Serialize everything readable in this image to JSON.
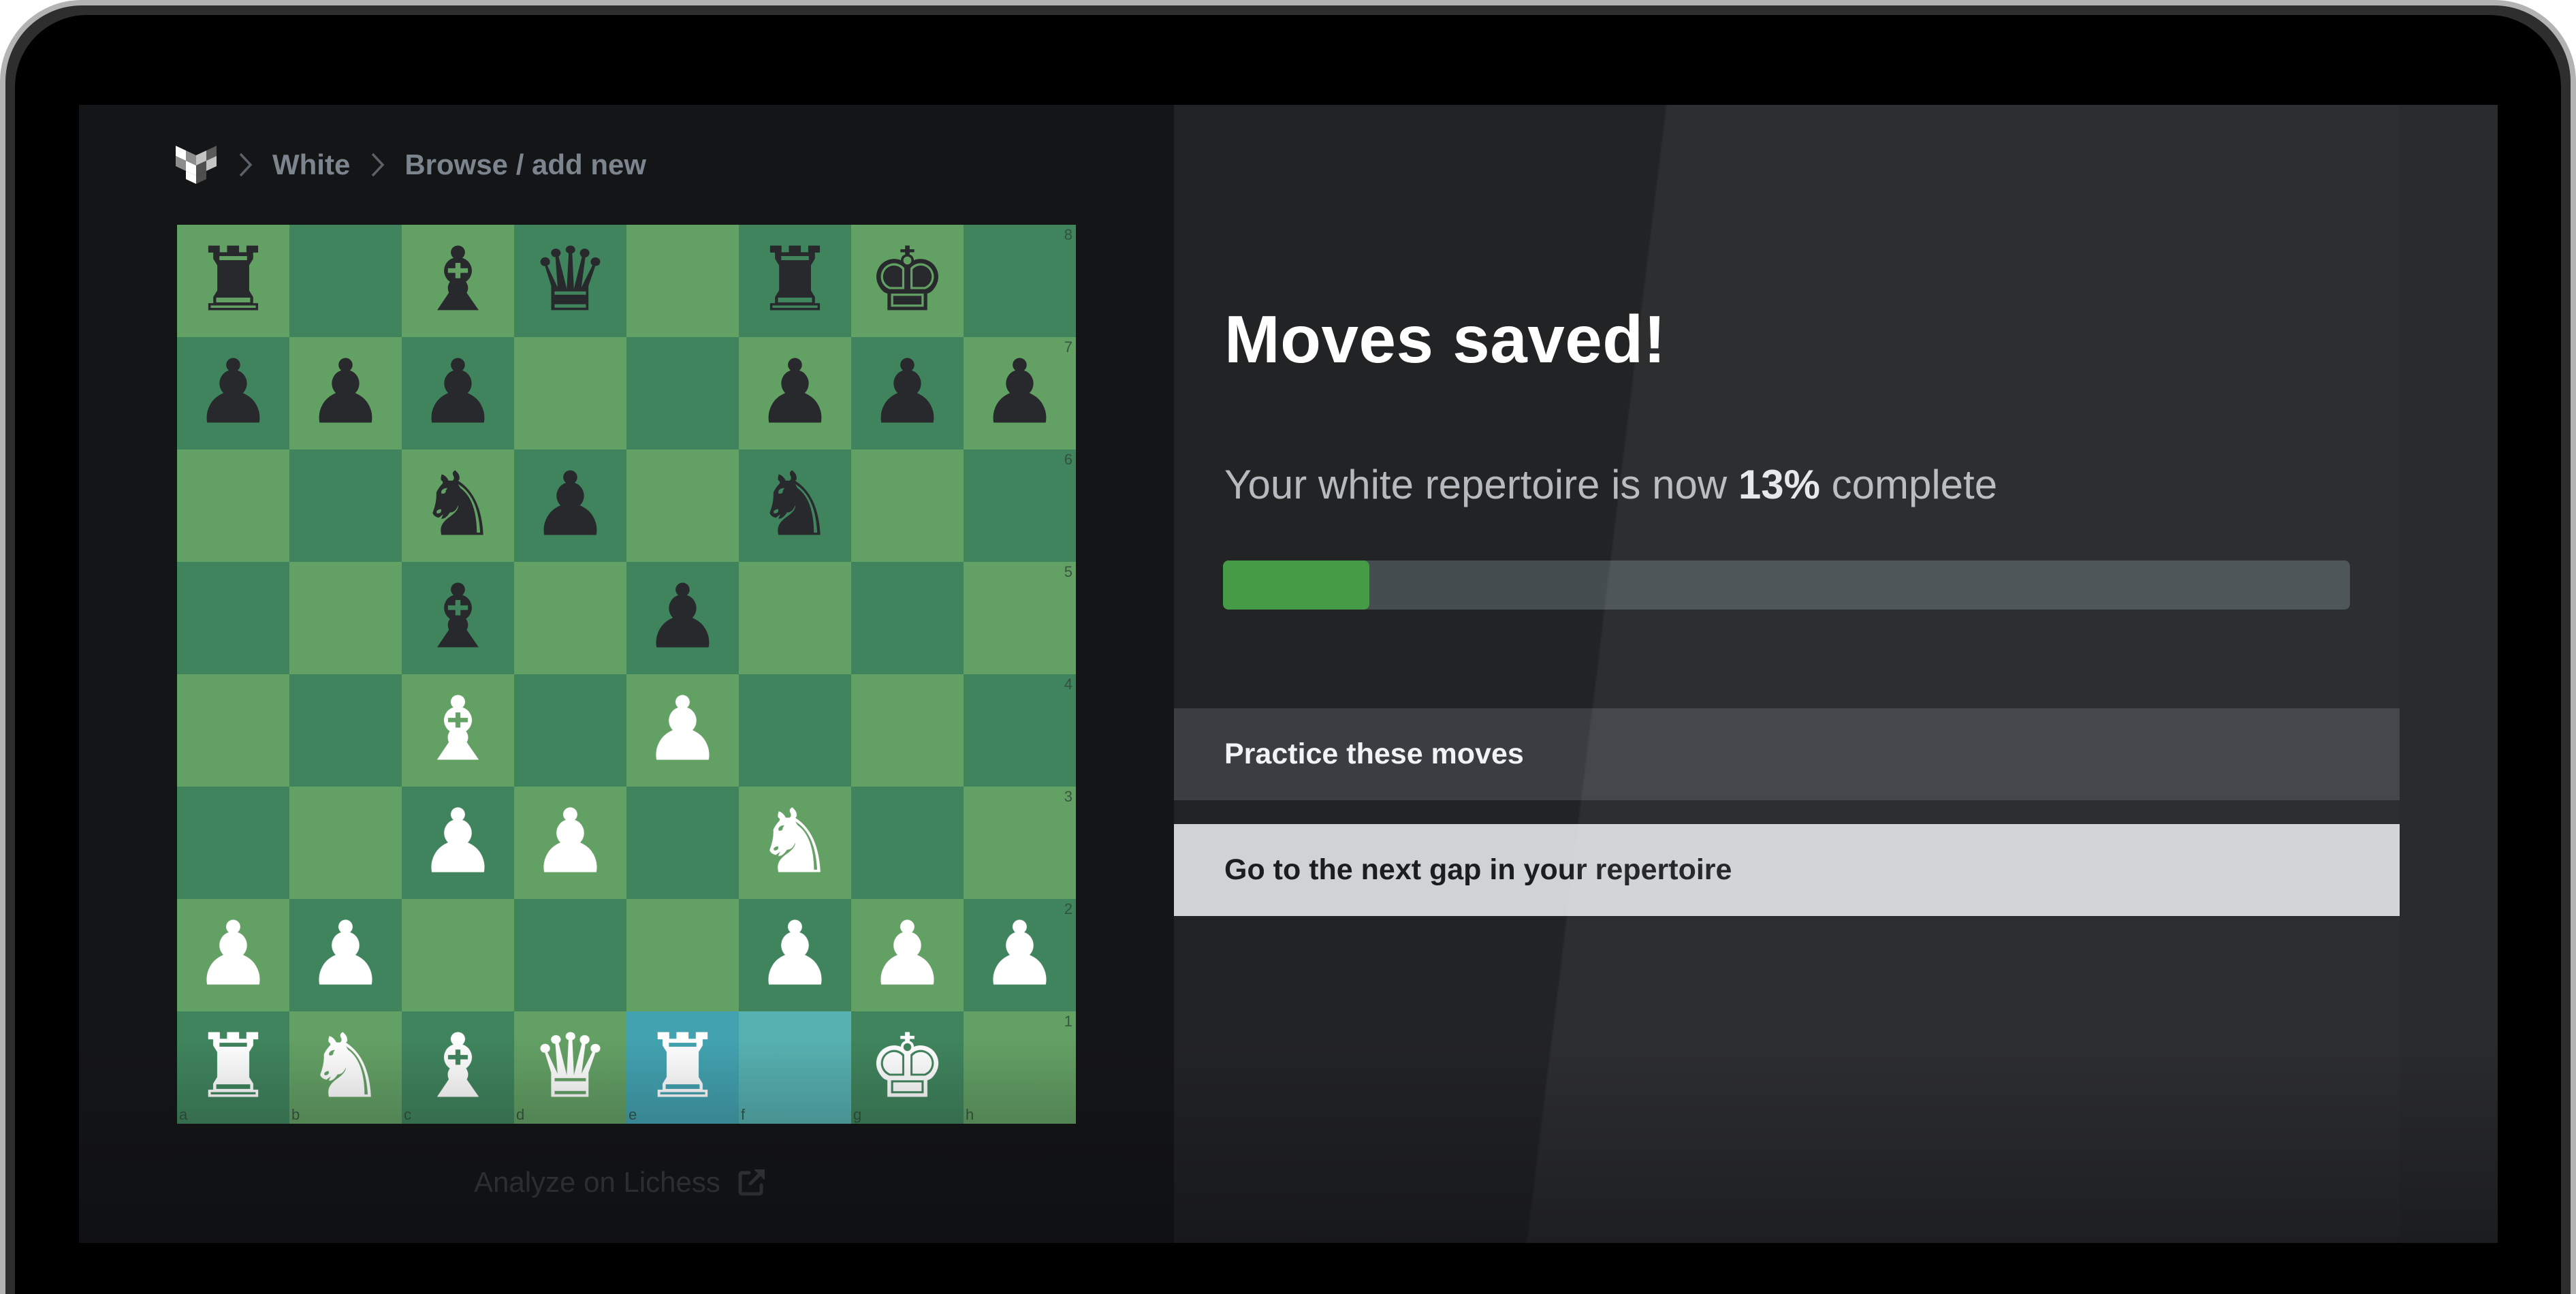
{
  "breadcrumb": {
    "logo_icon": "chessbook-logo-icon",
    "separator_icon": "chevron-right-icon",
    "items": [
      "White",
      "Browse / add new"
    ]
  },
  "board": {
    "orientation": "white",
    "ranks_top_to_bottom": [
      [
        "bR",
        "",
        "bB",
        "bQ",
        "",
        "bR",
        "bK",
        ""
      ],
      [
        "bP",
        "bP",
        "bP",
        "",
        "",
        "bP",
        "bP",
        "bP"
      ],
      [
        "",
        "",
        "bN",
        "bP",
        "",
        "bN",
        "",
        ""
      ],
      [
        "",
        "",
        "bB",
        "",
        "bP",
        "",
        "",
        ""
      ],
      [
        "",
        "",
        "wB",
        "",
        "wP",
        "",
        "",
        ""
      ],
      [
        "",
        "",
        "wP",
        "wP",
        "",
        "wN",
        "",
        ""
      ],
      [
        "wP",
        "wP",
        "",
        "",
        "",
        "wP",
        "wP",
        "wP"
      ],
      [
        "wR",
        "wN",
        "wB",
        "wQ",
        "wR",
        "",
        "wK",
        ""
      ]
    ],
    "rank_labels": [
      "8",
      "7",
      "6",
      "5",
      "4",
      "3",
      "2",
      "1"
    ],
    "file_labels": [
      "a",
      "b",
      "c",
      "d",
      "e",
      "f",
      "g",
      "h"
    ],
    "last_move_highlight": [
      "e1",
      "f1"
    ],
    "colors": {
      "light": "#63a064",
      "dark": "#3f845d",
      "highlight_dark": "#42a2b0",
      "highlight_light": "#56b1b0"
    }
  },
  "analyze_link": {
    "label": "Analyze on Lichess",
    "icon": "external-link-icon"
  },
  "main": {
    "title": "Moves saved!",
    "subtitle_prefix": "Your white repertoire is now ",
    "subtitle_percent": "13%",
    "subtitle_suffix": " complete",
    "progress_percent": 13,
    "progress_color": "#469b46",
    "buttons": {
      "practice": "Practice these moves",
      "next_gap": "Go to the next gap in your repertoire"
    }
  }
}
